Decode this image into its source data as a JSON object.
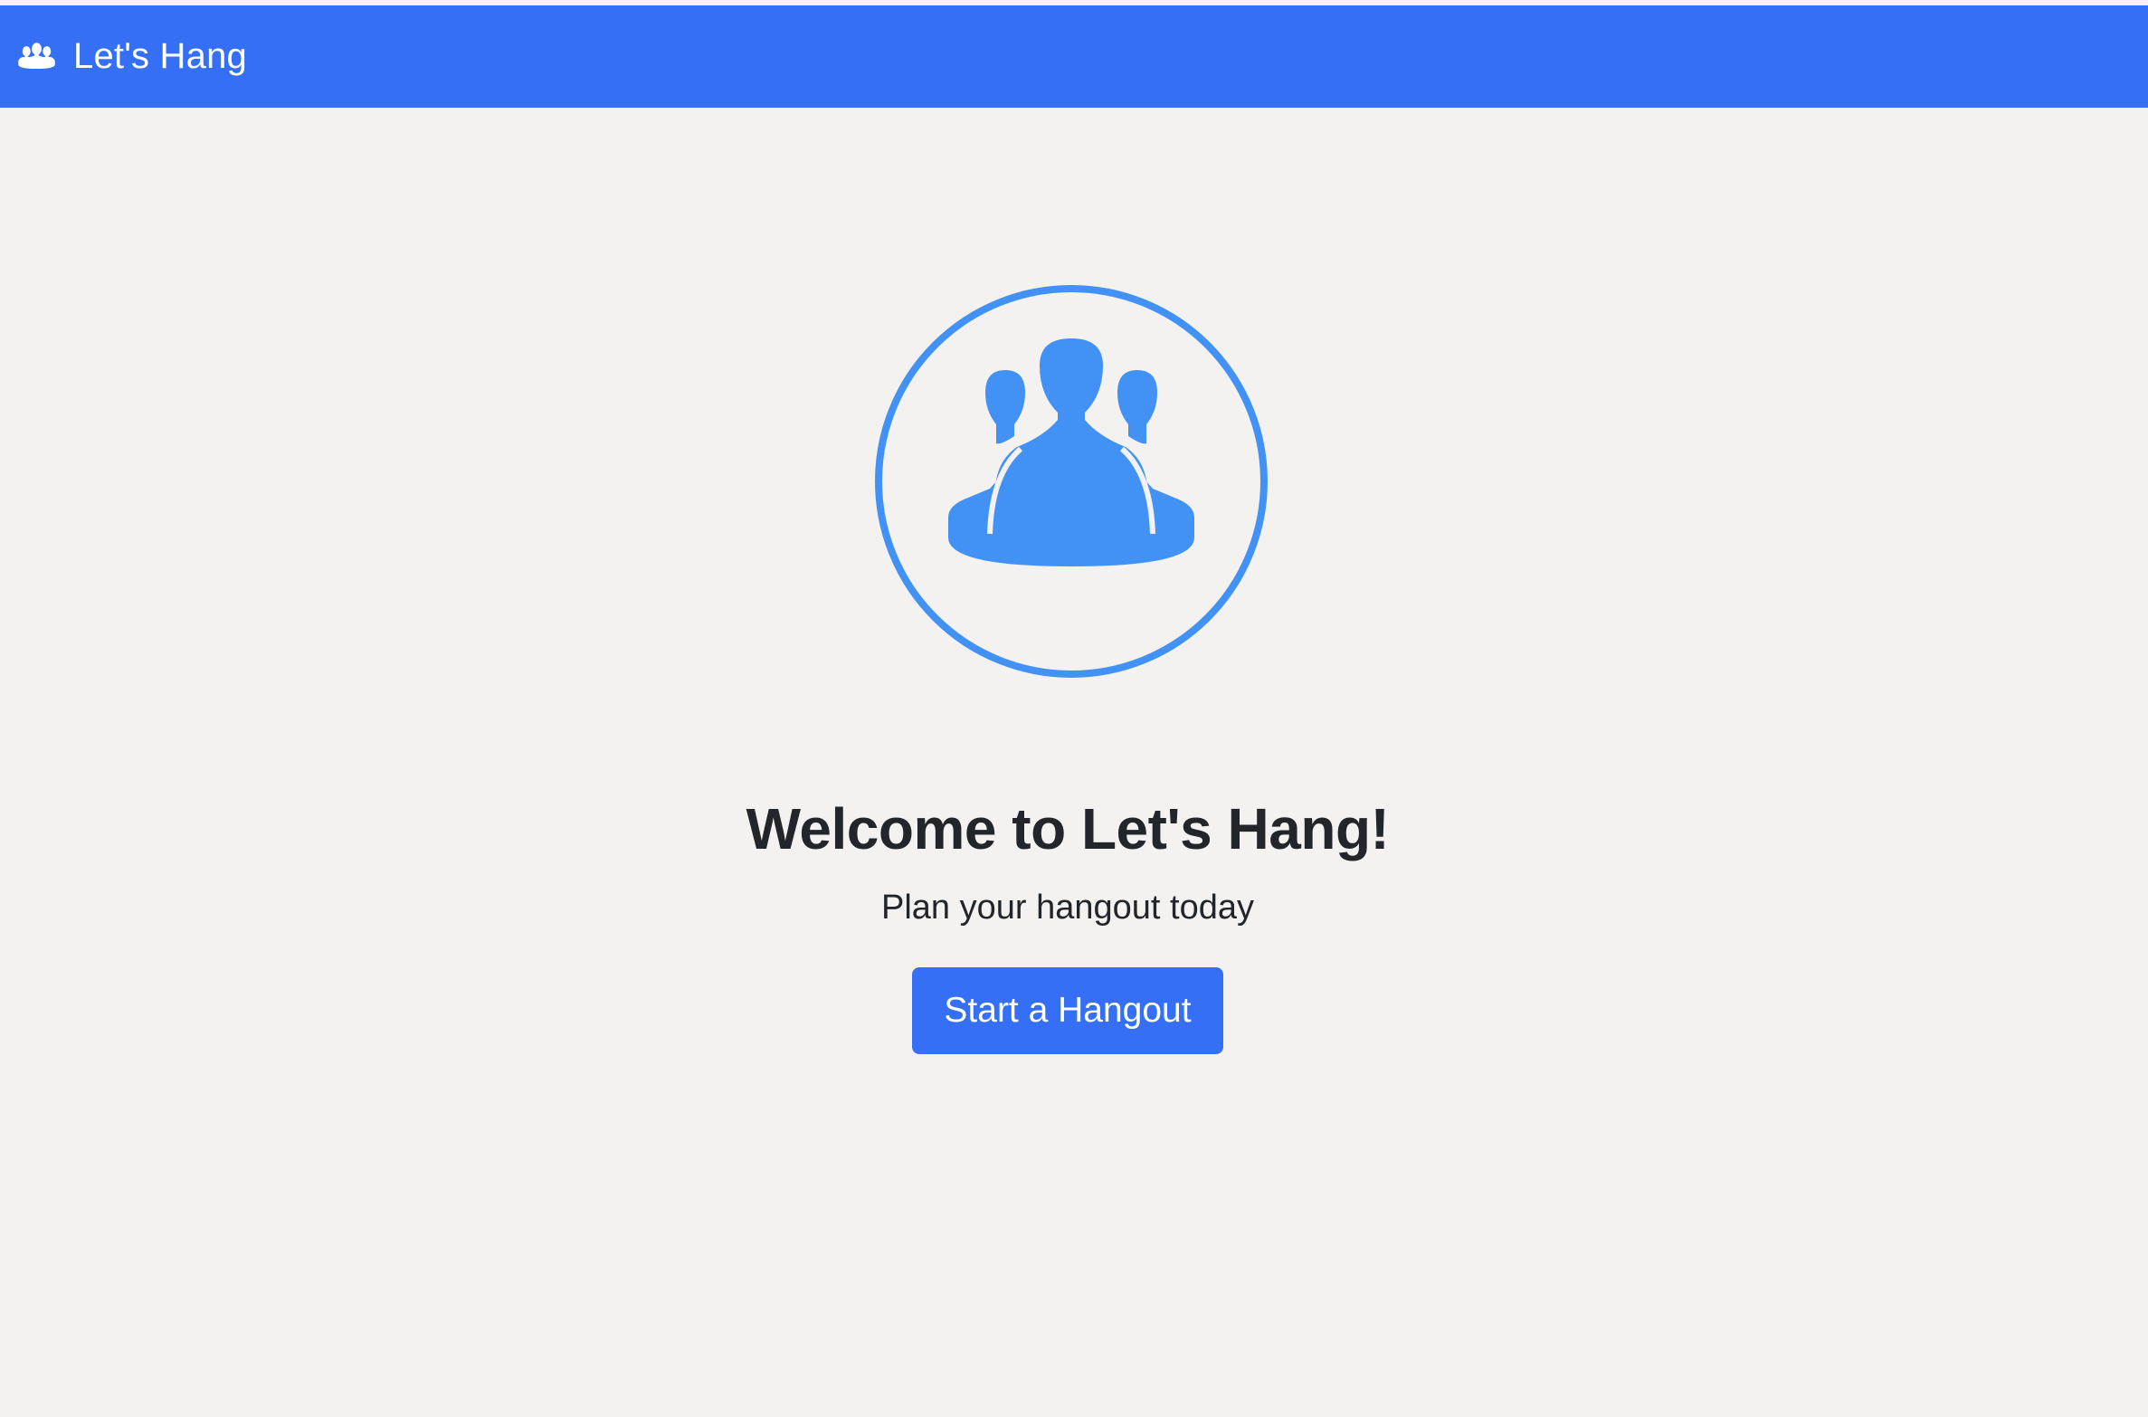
{
  "navbar": {
    "brand_icon": "people-group-icon",
    "brand_label": "Let's Hang"
  },
  "hero": {
    "icon": "people-group-icon",
    "title": "Welcome to Let's Hang!",
    "subtitle": "Plan your hangout today",
    "cta_label": "Start a Hangout"
  },
  "colors": {
    "brand_blue": "#356ff5",
    "icon_blue": "#4292f6",
    "page_background": "#f3f2f1",
    "text_dark": "#22252a"
  }
}
